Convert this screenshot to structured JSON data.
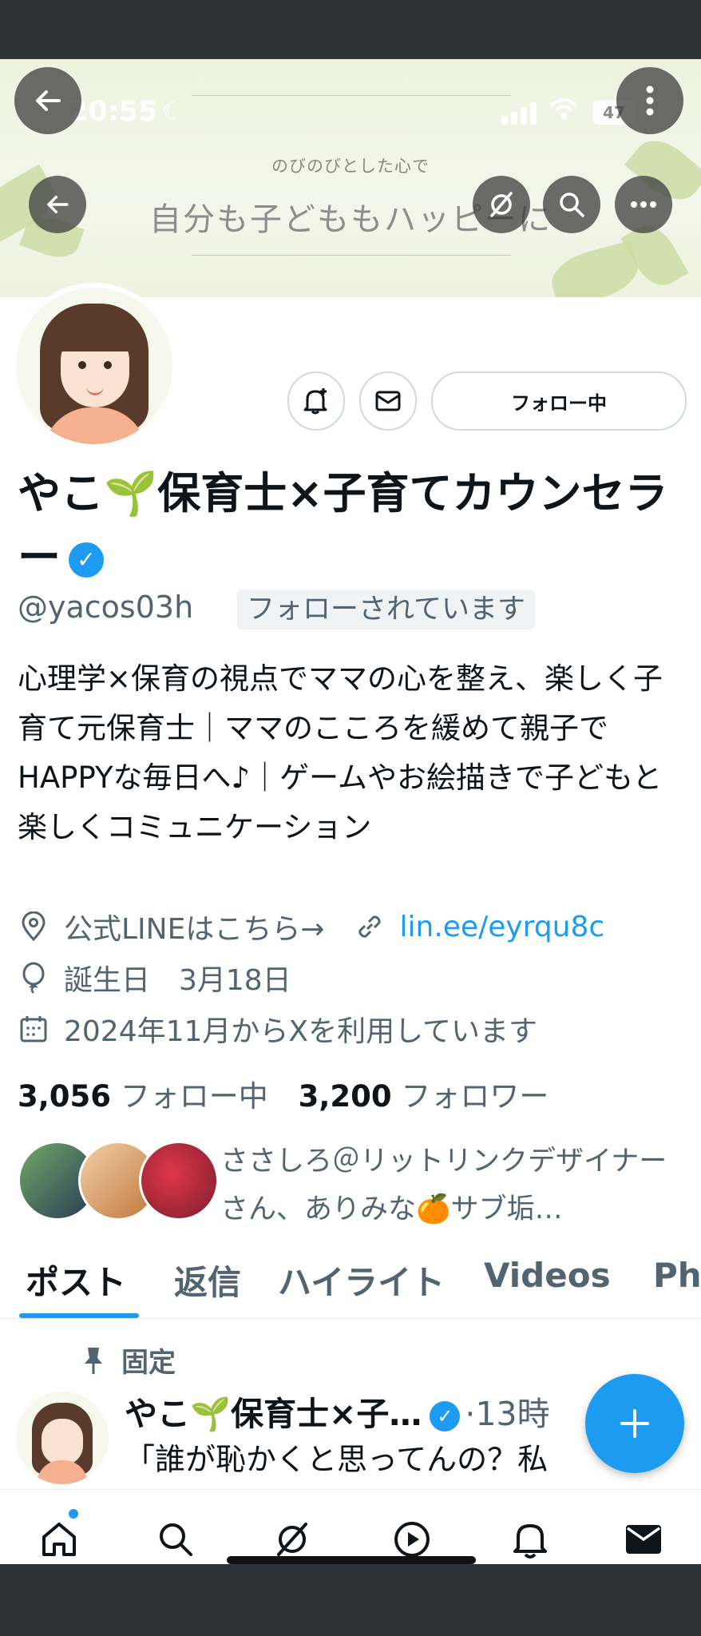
{
  "status": {
    "time": "20:55",
    "battery": "47"
  },
  "banner": {
    "subtitle": "のびのびとした心で",
    "title": "自分も子どももハッピーに"
  },
  "profile": {
    "name": "やこ🌱保育士×子育てカウンセラー",
    "verified_mark": "✓",
    "handle": "@yacos03h",
    "follows_you": "フォローされています",
    "follow_button": "フォロー中",
    "bio": "心理学×保育の視点でママの心を整え、楽しく子育て元保育士｜ママのこころを緩めて親子でHAPPYな毎日へ♪｜ゲームやお絵描きで子どもと楽しくコミュニケーション",
    "location": "公式LINEはこちら→",
    "link": "lin.ee/eyrqu8c",
    "birthday": "誕生日　3月18日",
    "joined": "2024年11月からXを利用しています",
    "following_count": "3,056",
    "following_label": "フォロー中",
    "followers_count": "3,200",
    "followers_label": "フォロワー",
    "known_followers": "ささしろ＠リットリンクデザイナーさん、ありみな🍊サブ垢…"
  },
  "tabs": [
    "ポスト",
    "返信",
    "ハイライト",
    "Videos",
    "Ph"
  ],
  "post": {
    "pinned_label": "固定",
    "author": "やこ🌱保育士×子…",
    "time": "·13時",
    "text": "「誰が恥かくと思ってんの？私"
  },
  "icons": {
    "back": "arrow-left-icon",
    "more": "more-vertical-icon",
    "grok": "grok-icon",
    "search": "search-icon",
    "ellipsis": "more-horizontal-icon",
    "notify": "bell-plus-icon",
    "message": "mail-icon",
    "fab": "plus-icon"
  },
  "colors": {
    "accent": "#1d9bf0",
    "text": "#0f1419",
    "muted": "#536471"
  }
}
